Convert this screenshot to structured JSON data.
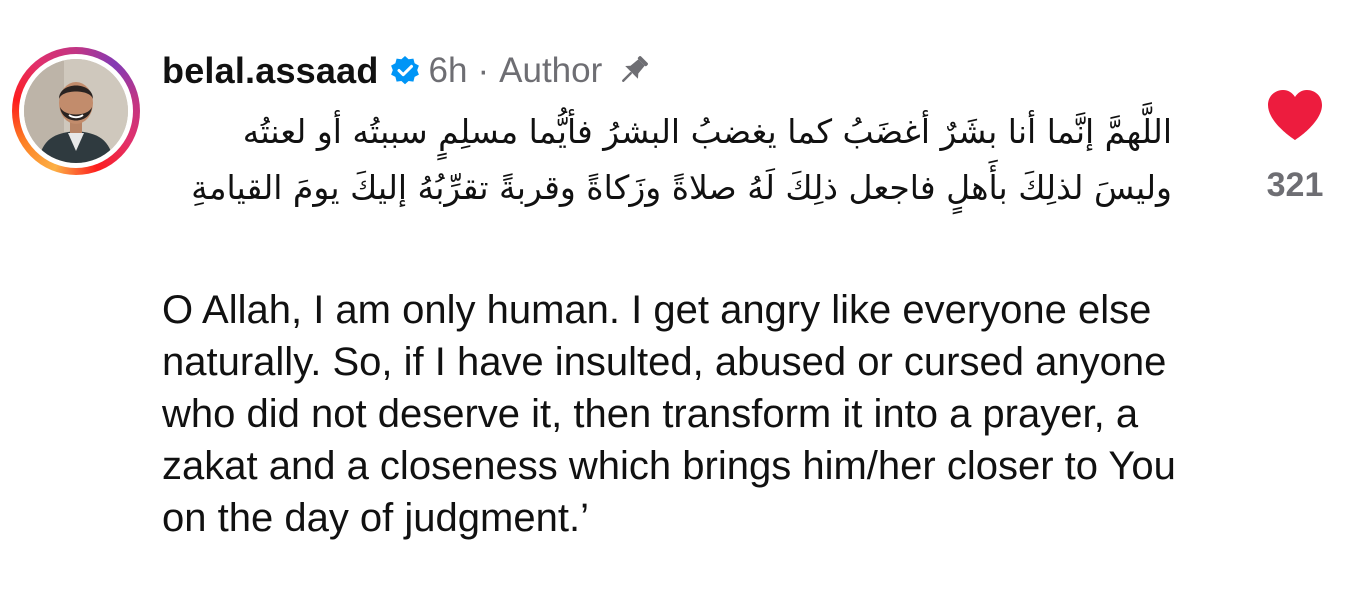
{
  "comment": {
    "username": "belal.assaad",
    "time": "6h",
    "separator": "·",
    "role": "Author",
    "arabic_text": "اللَّهمَّ إنَّما أنا بشَرٌ أغضَبُ كما يغضبُ البشرُ فأيُّما مسلِمٍ سببتُه أو لعنتُه وليسَ لذلِكَ بأَهلٍ فاجعل ذلِكَ لَهُ صلاةً وزَكاةً وقربةً تقرِّبُهُ إليكَ يومَ القيامةِ",
    "english_text": "O Allah, I am only human. I get angry like everyone else naturally. So, if I have insulted, abused or cursed anyone who did not deserve it, then transform it into a prayer, a zakat and a closeness which brings him/her closer to You on the day of judgment.’",
    "like_count": "321"
  },
  "icons": {
    "avatar": "profile-photo",
    "verified": "verified-badge-icon",
    "pin": "pin-icon",
    "like": "heart-icon"
  },
  "colors": {
    "heart": "#ed1c3e",
    "verified": "#0095f6",
    "meta": "#6e6e73",
    "text": "#111111"
  }
}
